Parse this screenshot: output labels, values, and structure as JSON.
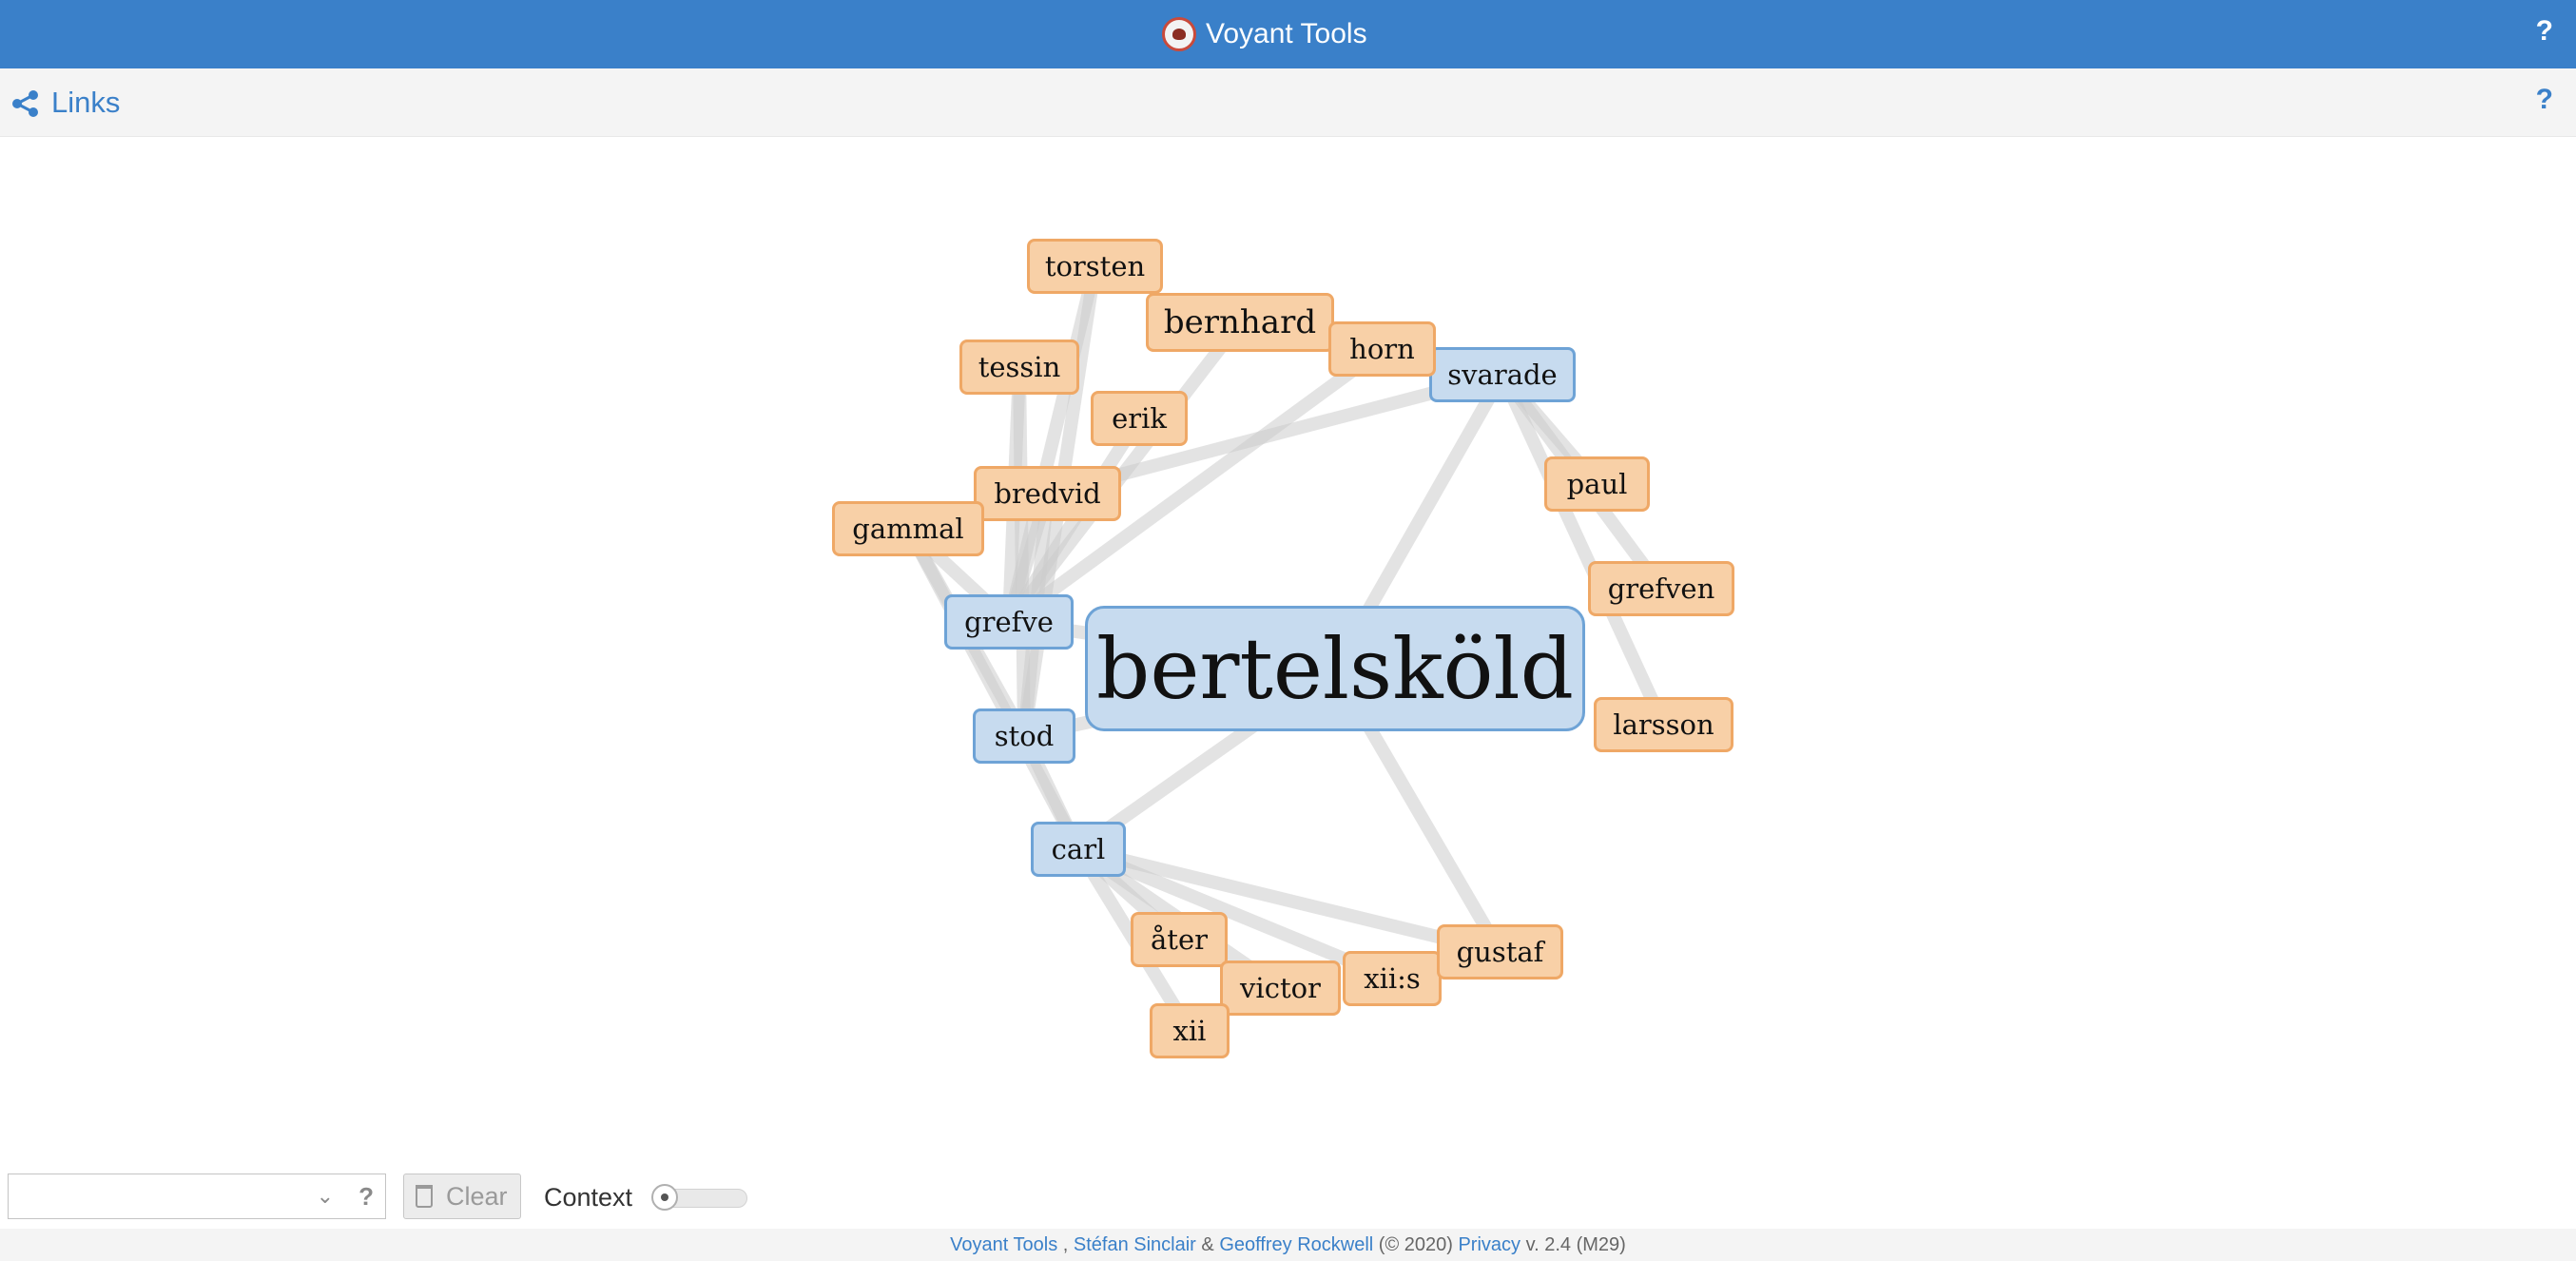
{
  "header": {
    "app_title": "Voyant Tools",
    "logo_icon": "voyant-owl-logo-icon",
    "help_label": "?"
  },
  "panel": {
    "title": "Links",
    "icon": "share-icon",
    "help_label": "?"
  },
  "graph": {
    "keyword_color": "#c7dbef",
    "context_color": "#f8d0a7",
    "edge_color": "#cccccc",
    "nodes": [
      {
        "id": "bertelskold",
        "term": "bertelsköld",
        "kind": "keyword"
      },
      {
        "id": "grefve",
        "term": "grefve",
        "kind": "keyword"
      },
      {
        "id": "stod",
        "term": "stod",
        "kind": "keyword"
      },
      {
        "id": "carl",
        "term": "carl",
        "kind": "keyword"
      },
      {
        "id": "svarade",
        "term": "svarade",
        "kind": "keyword"
      },
      {
        "id": "torsten",
        "term": "torsten",
        "kind": "context"
      },
      {
        "id": "bernhard",
        "term": "bernhard",
        "kind": "context"
      },
      {
        "id": "horn",
        "term": "horn",
        "kind": "context"
      },
      {
        "id": "tessin",
        "term": "tessin",
        "kind": "context"
      },
      {
        "id": "erik",
        "term": "erik",
        "kind": "context"
      },
      {
        "id": "bredvid",
        "term": "bredvid",
        "kind": "context"
      },
      {
        "id": "gammal",
        "term": "gammal",
        "kind": "context"
      },
      {
        "id": "paul",
        "term": "paul",
        "kind": "context"
      },
      {
        "id": "grefven",
        "term": "grefven",
        "kind": "context"
      },
      {
        "id": "larsson",
        "term": "larsson",
        "kind": "context"
      },
      {
        "id": "ater",
        "term": "åter",
        "kind": "context"
      },
      {
        "id": "victor",
        "term": "victor",
        "kind": "context"
      },
      {
        "id": "xiis",
        "term": "xii:s",
        "kind": "context"
      },
      {
        "id": "gustaf",
        "term": "gustaf",
        "kind": "context"
      },
      {
        "id": "xii",
        "term": "xii",
        "kind": "context"
      }
    ],
    "links": [
      [
        "grefve",
        "torsten"
      ],
      [
        "grefve",
        "tessin"
      ],
      [
        "grefve",
        "bernhard"
      ],
      [
        "grefve",
        "horn"
      ],
      [
        "grefve",
        "erik"
      ],
      [
        "grefve",
        "bredvid"
      ],
      [
        "grefve",
        "gammal"
      ],
      [
        "stod",
        "tessin"
      ],
      [
        "stod",
        "torsten"
      ],
      [
        "stod",
        "bredvid"
      ],
      [
        "stod",
        "gammal"
      ],
      [
        "bertelskold",
        "svarade"
      ],
      [
        "bertelskold",
        "stod"
      ],
      [
        "bertelskold",
        "gustaf"
      ],
      [
        "bertelskold",
        "grefve"
      ],
      [
        "bertelskold",
        "carl"
      ],
      [
        "svarade",
        "paul"
      ],
      [
        "svarade",
        "grefven"
      ],
      [
        "svarade",
        "larsson"
      ],
      [
        "svarade",
        "bredvid"
      ],
      [
        "carl",
        "stod"
      ],
      [
        "carl",
        "ater"
      ],
      [
        "carl",
        "victor"
      ],
      [
        "carl",
        "xiis"
      ],
      [
        "carl",
        "gustaf"
      ],
      [
        "carl",
        "xii"
      ],
      [
        "carl",
        "gammal"
      ]
    ]
  },
  "toolbar": {
    "combo_value": "",
    "help_label": "?",
    "clear_label": "Clear",
    "context_label": "Context"
  },
  "footer": {
    "voyant": "Voyant Tools",
    "sep1": " , ",
    "sinclair": "Stéfan Sinclair",
    "amp": " & ",
    "rockwell": "Geoffrey Rockwell",
    "year": " (© 2020) ",
    "privacy": "Privacy",
    "version": " v. 2.4 (M29)"
  }
}
